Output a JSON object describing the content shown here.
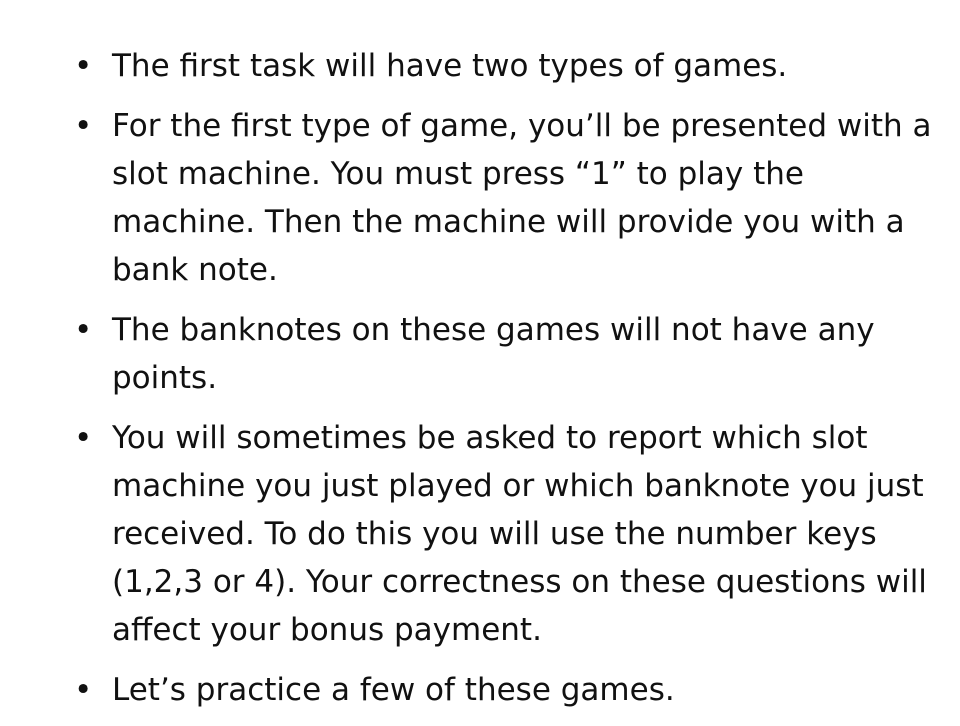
{
  "slide": {
    "bullets": [
      {
        "marker": "•",
        "text": "The first task will have two types of games."
      },
      {
        "marker": "•",
        "text": "For the first type of game, you’ll be presented with a slot machine. You must press “1” to play the machine. Then the machine will provide you with a bank note."
      },
      {
        "marker": "•",
        "text": "The banknotes on these games will not have any points."
      },
      {
        "marker": "•",
        "text": "You will sometimes be asked to report which slot machine you just played or which banknote you just received. To do this you will use the number keys (1,2,3 or 4). Your correctness on these questions will affect your bonus payment."
      },
      {
        "marker": "•",
        "text": "Let’s practice a few of these games."
      }
    ]
  }
}
